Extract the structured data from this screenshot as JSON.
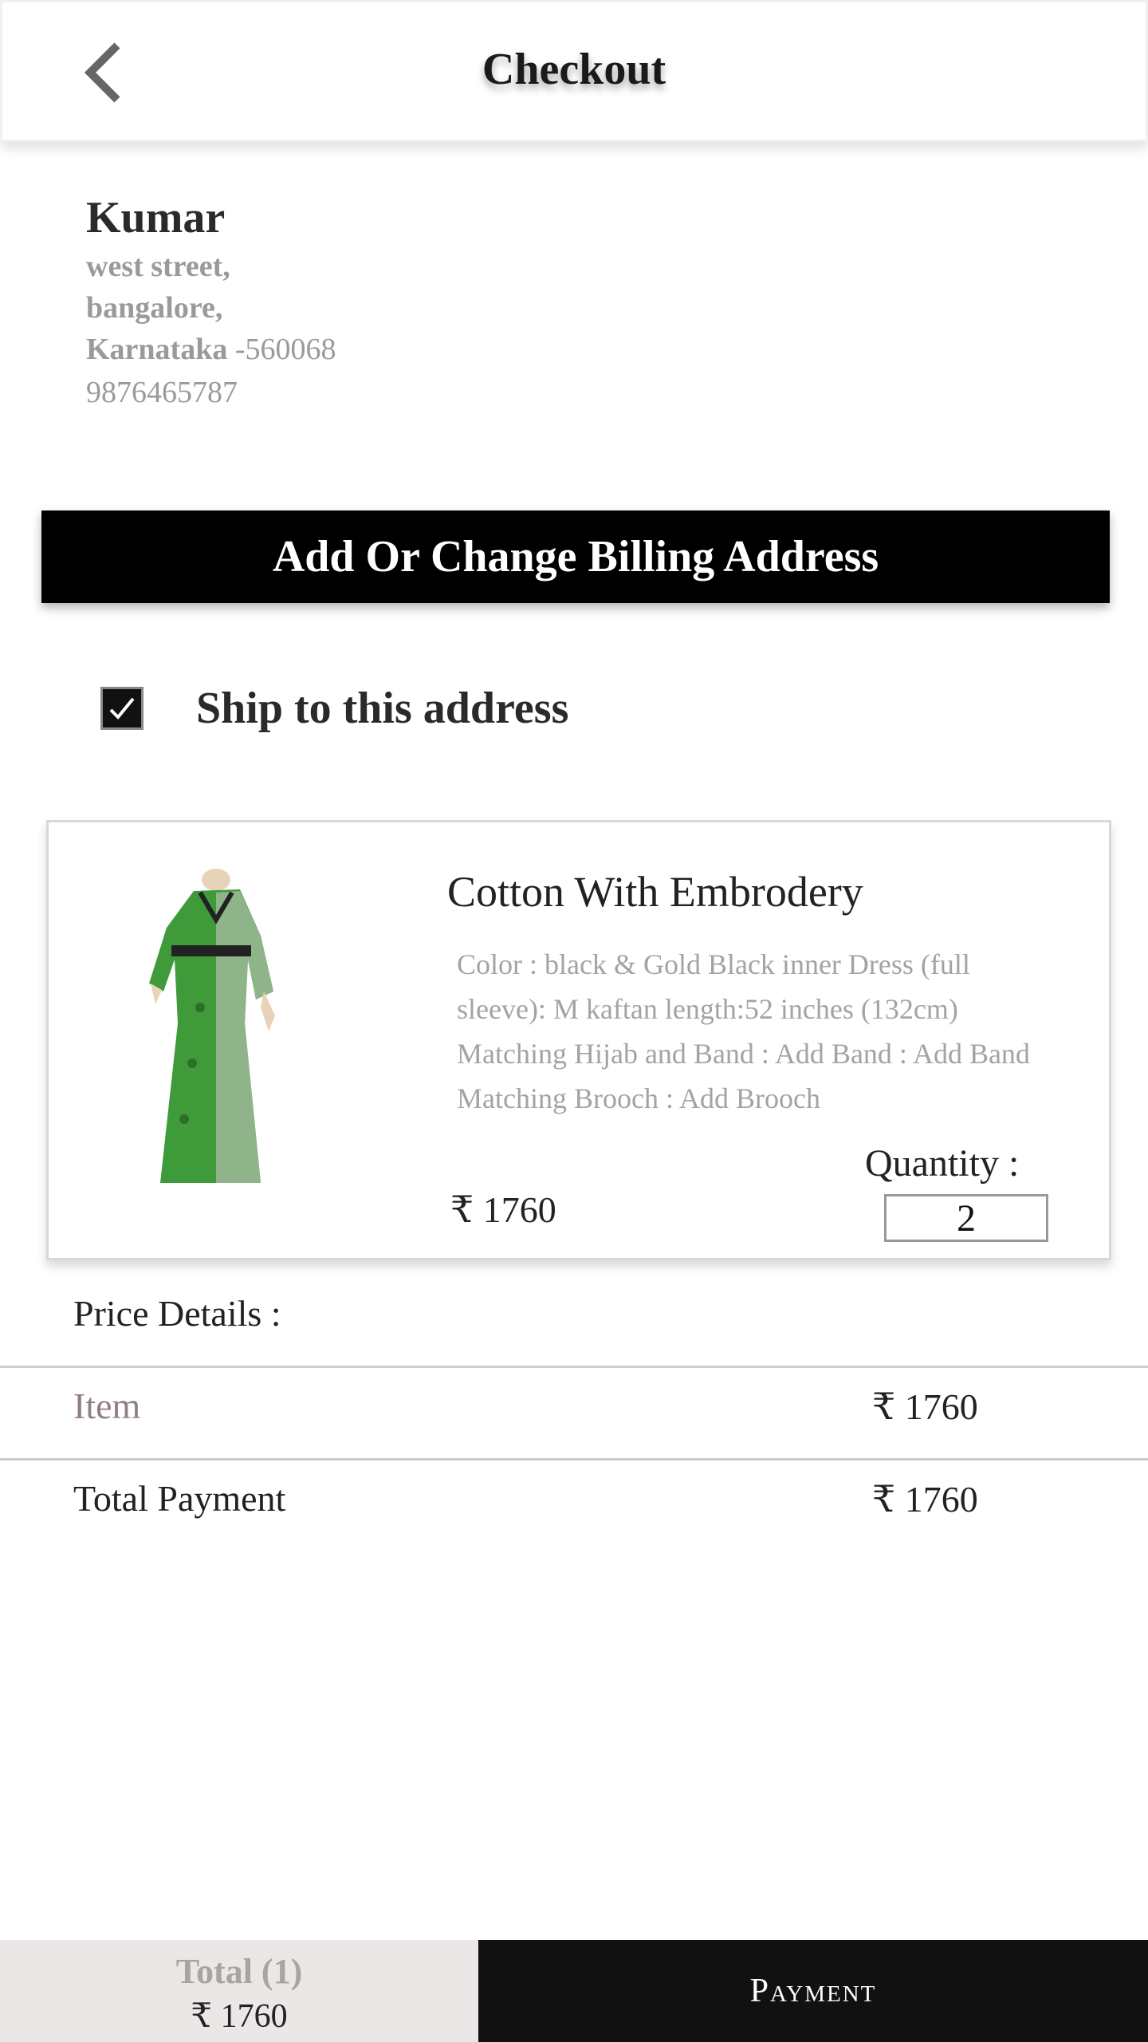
{
  "header": {
    "title": "Checkout",
    "back_icon": "chevron-left-icon"
  },
  "address": {
    "name": "Kumar",
    "street": "west street,",
    "city": "bangalore,",
    "state": "Karnataka",
    "pincode": " -560068",
    "phone": "9876465787"
  },
  "billing_button": {
    "label": "Add Or Change Billing Address"
  },
  "ship_option": {
    "label": "Ship to this address",
    "checked": true
  },
  "product": {
    "name": "Cotton With Embrodery",
    "description": "Color : black & Gold Black inner Dress (full sleeve): M kaftan length:52 inches (132cm) Matching  Hijab and Band : Add  Band : Add Band Matching Brooch : Add Brooch",
    "price": "₹ 1760",
    "quantity_label": "Quantity :",
    "quantity": "2",
    "image_icon": "kaftan-dress-image"
  },
  "price_details": {
    "heading": "Price Details :",
    "item_label": "Item",
    "item_value": "₹ 1760",
    "total_label": "Total Payment",
    "total_value": "₹ 1760"
  },
  "footer": {
    "total_label": "Total (1)",
    "total_amount": "₹ 1760",
    "payment_label": "Payment"
  },
  "colors": {
    "accent": "#000000",
    "footer_left_bg": "#ebe7e7",
    "muted_text": "#9a9a9a",
    "item_label": "#8f7f82"
  }
}
